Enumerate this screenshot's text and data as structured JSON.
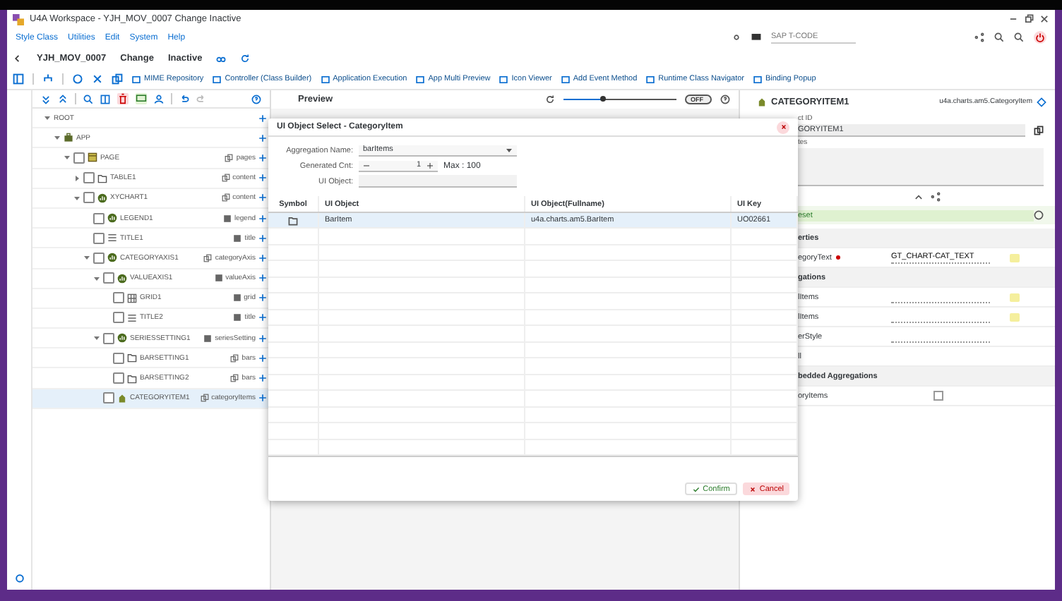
{
  "window": {
    "title": "U4A Workspace - YJH_MOV_0007 Change Inactive"
  },
  "menu": [
    "Style Class",
    "Utilities",
    "Edit",
    "System",
    "Help"
  ],
  "tcode": {
    "placeholder": "SAP T-CODE"
  },
  "app_header": {
    "program": "YJH_MOV_0007",
    "mode": "Change",
    "status": "Inactive"
  },
  "toolbar": [
    "MIME Repository",
    "Controller (Class Builder)",
    "Application Execution",
    "App Multi Preview",
    "Icon Viewer",
    "Add Event Method",
    "Runtime Class Navigator",
    "Binding Popup"
  ],
  "tree": [
    {
      "name": "ROOT",
      "expanded": true,
      "children": [
        {
          "name": "APP",
          "kind": "app",
          "expanded": true,
          "children": [
            {
              "name": "PAGE",
              "kind": "page",
              "agg": "pages",
              "multiple": true,
              "checked": false,
              "selected": false,
              "expanded": true,
              "children": [
                {
                  "name": "TABLE1",
                  "kind": "folder",
                  "agg": "content",
                  "multiple": true,
                  "checked": false,
                  "selected": false,
                  "expanded": false
                },
                {
                  "name": "XYCHART1",
                  "kind": "chart",
                  "agg": "content",
                  "multiple": true,
                  "checked": false,
                  "selected": false,
                  "expanded": true,
                  "children": [
                    {
                      "name": "LEGEND1",
                      "kind": "chart",
                      "agg": "legend",
                      "multiple": false,
                      "checked": false,
                      "selected": false
                    },
                    {
                      "name": "TITLE1",
                      "kind": "title",
                      "agg": "title",
                      "multiple": false,
                      "checked": false,
                      "selected": false
                    },
                    {
                      "name": "CATEGORYAXIS1",
                      "kind": "chart",
                      "agg": "categoryAxis",
                      "multiple": true,
                      "checked": false,
                      "selected": false,
                      "expanded": true,
                      "children": [
                        {
                          "name": "VALUEAXIS1",
                          "kind": "chart",
                          "agg": "valueAxis",
                          "multiple": false,
                          "checked": false,
                          "selected": false,
                          "expanded": true,
                          "children": [
                            {
                              "name": "GRID1",
                              "kind": "grid",
                              "agg": "grid",
                              "multiple": false,
                              "checked": false,
                              "selected": false
                            },
                            {
                              "name": "TITLE2",
                              "kind": "title",
                              "agg": "title",
                              "multiple": false,
                              "checked": false,
                              "selected": false
                            }
                          ]
                        },
                        {
                          "name": "SERIESSETTING1",
                          "kind": "chart",
                          "agg": "seriesSetting",
                          "multiple": false,
                          "checked": false,
                          "selected": false,
                          "expanded": true,
                          "children": [
                            {
                              "name": "BARSETTING1",
                              "kind": "folder",
                              "agg": "bars",
                              "multiple": true,
                              "checked": false,
                              "selected": false
                            },
                            {
                              "name": "BARSETTING2",
                              "kind": "folder",
                              "agg": "bars",
                              "multiple": true,
                              "checked": false,
                              "selected": false
                            }
                          ]
                        },
                        {
                          "name": "CATEGORYITEM1",
                          "kind": "item",
                          "agg": "categoryItems",
                          "multiple": true,
                          "checked": false,
                          "selected": true
                        }
                      ]
                    }
                  ]
                }
              ]
            }
          ]
        }
      ]
    }
  ],
  "preview": {
    "title": "Preview",
    "slider": {
      "level": 0.35
    },
    "toggle": {
      "label": "OFF",
      "on": false
    }
  },
  "right_panel": {
    "title": "CATEGORYITEM1",
    "class_name": "u4a.charts.am5.CategoryItem",
    "object_id_label": "ct ID",
    "object_id": "GORYITEM1",
    "description_label": "tes",
    "reset": "eset",
    "rows": [
      {
        "kind": "section",
        "label": "erties"
      },
      {
        "kind": "input",
        "label": "egoryText",
        "required": true,
        "value": "GT_CHART-CAT_TEXT",
        "bound": true
      },
      {
        "kind": "section",
        "label": "gations"
      },
      {
        "kind": "input",
        "label": "lItems",
        "required": false,
        "value": "",
        "bound": true
      },
      {
        "kind": "input",
        "label": "lItems",
        "required": false,
        "value": "",
        "bound": true
      },
      {
        "kind": "input",
        "label": "erStyle",
        "required": false,
        "value": "",
        "bound": false
      },
      {
        "kind": "plain",
        "label": "ll"
      },
      {
        "kind": "section",
        "label": "bedded Aggregations"
      },
      {
        "kind": "check",
        "label": "oryItems",
        "checked": false
      }
    ]
  },
  "dialog": {
    "title": "UI Object Select - CategoryItem",
    "aggregation_label": "Aggregation Name:",
    "aggregation_value": "barItems",
    "count_label": "Generated Cnt:",
    "count_value": "1",
    "count_max": "Max : 100",
    "object_label": "UI Object:",
    "columns": [
      "Symbol",
      "UI Object",
      "UI Object(Fullname)",
      "UI Key"
    ],
    "rows": [
      {
        "object": "BarItem",
        "fullname": "u4a.charts.am5.BarItem",
        "key": "UO02661",
        "selected": true
      }
    ],
    "buttons": [
      {
        "kind": "confirm",
        "label": "Confirm"
      },
      {
        "kind": "cancel",
        "label": "Cancel"
      }
    ]
  }
}
